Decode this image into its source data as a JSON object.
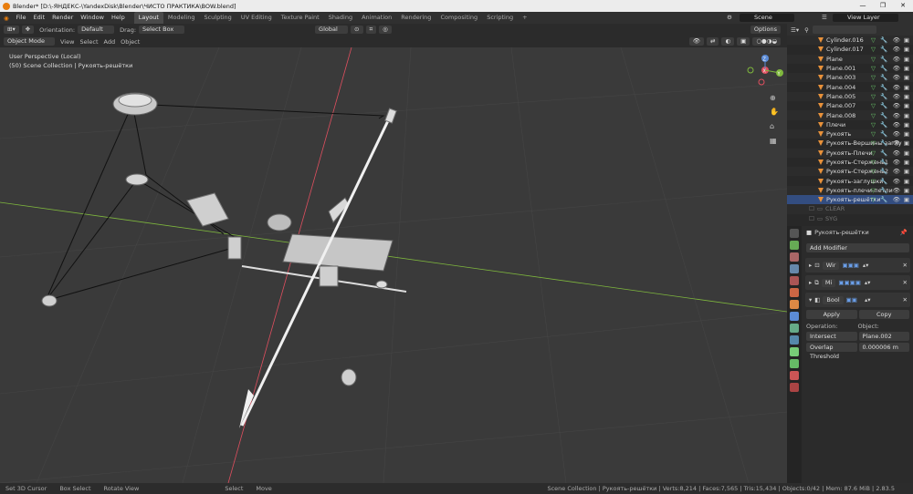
{
  "window": {
    "title": "Blender* [D:\\-ЯНДЕКС-\\YandexDisk\\Blender\\ЧИСТО ПРАКТИКА\\BOW.blend]",
    "controls": [
      "—",
      "❐",
      "✕"
    ]
  },
  "menu": [
    "File",
    "Edit",
    "Render",
    "Window",
    "Help"
  ],
  "workspaces": [
    {
      "label": "Layout",
      "active": true
    },
    {
      "label": "Modeling"
    },
    {
      "label": "Sculpting"
    },
    {
      "label": "UV Editing"
    },
    {
      "label": "Texture Paint"
    },
    {
      "label": "Shading"
    },
    {
      "label": "Animation"
    },
    {
      "label": "Rendering"
    },
    {
      "label": "Compositing"
    },
    {
      "label": "Scripting"
    }
  ],
  "scene": "Scene",
  "view_layer": "View Layer",
  "tool_header": {
    "orientation_label": "Orientation:",
    "orientation_value": "Default",
    "drag_label": "Drag:",
    "drag_value": "Select Box",
    "transform_space": "Global",
    "options": "Options"
  },
  "view_header": {
    "mode": "Object Mode",
    "menus": [
      "View",
      "Select",
      "Add",
      "Object"
    ]
  },
  "viewport_info": {
    "line1": "User Perspective (Local)",
    "line2": "(50) Scene Collection | Рукоять-решётки"
  },
  "gizmo": {
    "x": "X",
    "y": "Y",
    "z": "Z"
  },
  "outliner": {
    "items": [
      {
        "name": "Cylinder.016"
      },
      {
        "name": "Cylinder.017"
      },
      {
        "name": "Plane"
      },
      {
        "name": "Plane.001"
      },
      {
        "name": "Plane.003"
      },
      {
        "name": "Plane.004"
      },
      {
        "name": "Plane.005"
      },
      {
        "name": "Plane.007"
      },
      {
        "name": "Plane.008"
      },
      {
        "name": "Плечи"
      },
      {
        "name": "Рукоять"
      },
      {
        "name": "Рукоять-Вершины заглу"
      },
      {
        "name": "Рукоять-Плечи"
      },
      {
        "name": "Рукоять-Стержень1"
      },
      {
        "name": "Рукоять-Стержень2"
      },
      {
        "name": "Рукоять-заглушки"
      },
      {
        "name": "Рукоять-плечи-петли"
      },
      {
        "name": "Рукоять-решётки",
        "selected": true
      }
    ],
    "collections": [
      {
        "name": "CLEAR"
      },
      {
        "name": "SYG"
      }
    ]
  },
  "properties": {
    "object_name": "Рукоять-решётки",
    "add_modifier": "Add Modifier",
    "modifiers": [
      {
        "name": "Wir"
      },
      {
        "name": "Mi"
      },
      {
        "name": "Bool"
      }
    ],
    "apply": "Apply",
    "copy": "Copy",
    "operation_label": "Operation:",
    "object_label": "Object:",
    "operation_value": "Intersect",
    "object_value": "Plane.002",
    "overlap_label": "Overlap Threshold",
    "overlap_value": "0.000006 m"
  },
  "status": {
    "left": [
      "Set 3D Cursor",
      "Box Select",
      "Rotate View",
      "Select",
      "Move"
    ],
    "right": "Scene Collection | Рукоять-решётки | Verts:8,214 | Faces:7,565 | Tris:15,434 | Objects:0/42 | Mem: 87.6 MiB | 2.83.5"
  },
  "colors": {
    "accent": "#e87d0d",
    "selection": "#334d80",
    "viewport_bg": "#3a3a3a",
    "x_axis": "#e04f5f",
    "y_axis": "#7fb83d"
  }
}
